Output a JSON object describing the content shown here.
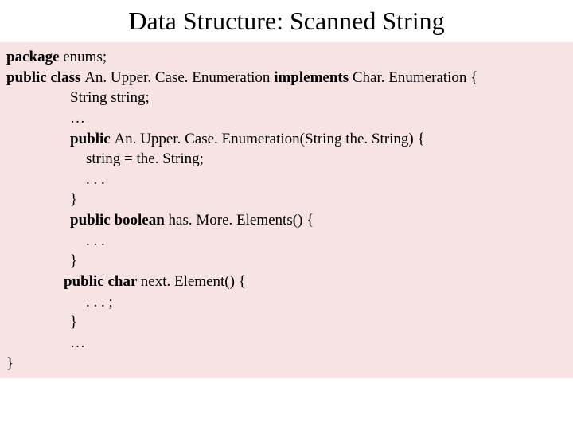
{
  "title": "Data Structure: Scanned String",
  "code": {
    "l0_kw": "package ",
    "l0_rest": "enums;",
    "l1_kw1": "public class ",
    "l1_txt1": "An. Upper. Case. Enumeration ",
    "l1_kw2": "implements ",
    "l1_txt2": "Char. Enumeration {",
    "l2": "String string;",
    "l3": "…",
    "l4_kw": "public ",
    "l4_rest": "An. Upper. Case. Enumeration(String the. String) {",
    "l5": "string = the. String;",
    "l6": ". . .",
    "l7": "}",
    "l8_kw": "public boolean ",
    "l8_rest": "has. More. Elements() {",
    "l9": ". . .",
    "l10": "}",
    "l11_kw": "public char ",
    "l11_rest": "next. Element() {",
    "l12": ". . . ;",
    "l13": "}",
    "l14": "…",
    "l15": "}"
  }
}
